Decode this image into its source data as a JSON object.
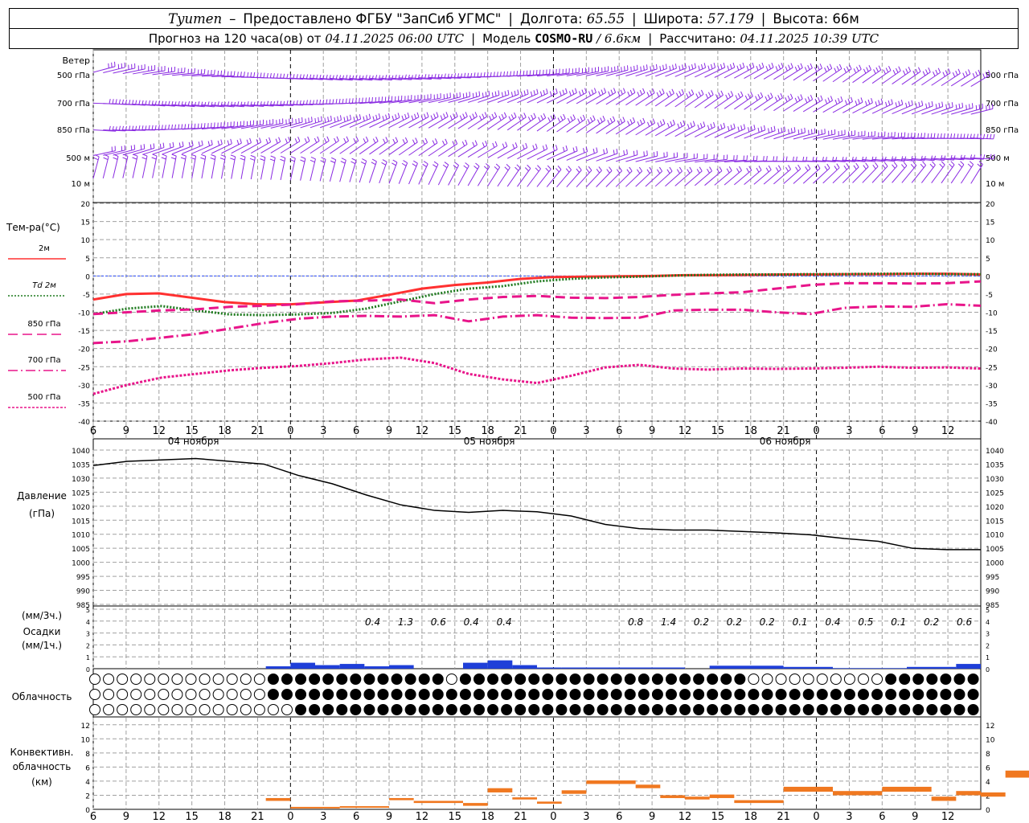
{
  "header": {
    "station": "Tyumen",
    "provider": "Предоставлено ФГБУ \"ЗапСиб УГМС\"",
    "lon_label": "Долгота:",
    "lon_value": "65.55",
    "lat_label": "Широта:",
    "lat_value": "57.179",
    "alt_label": "Высота:",
    "alt_value": "66м",
    "forecast_prefix": "Прогноз на 120 часа(ов) от",
    "forecast_time": "04.11.2025 06:00 UTC",
    "model_label": "Модель",
    "model_name": "COSMO-RU",
    "model_res": "/ 6.6км",
    "calc_label": "Рассчитано:",
    "calc_time": "04.11.2025 10:39 UTC"
  },
  "colors": {
    "wind": "#8a2be2",
    "t2m": "#ff3030",
    "td2m": "#1e7a1e",
    "t850": "#e8158a",
    "t700": "#e8158a",
    "t500": "#e8158a",
    "pressure": "#000000",
    "precip3h": "#1f3fd8",
    "precip1h": "#2bb52b",
    "conv": "#f07820",
    "grid": "#a0a0a0"
  },
  "chart_data": [
    {
      "type": "barbs",
      "title": "Ветер",
      "levels": [
        "500 гПа",
        "700 гПа",
        "850 гПа",
        "500 м",
        "10 м"
      ]
    },
    {
      "type": "line",
      "ylabel": "Тем-ра(°C)",
      "ylim": [
        -40,
        20
      ],
      "yticks": [
        -40,
        -35,
        -30,
        -25,
        -20,
        -15,
        -10,
        -5,
        0,
        5,
        10,
        15,
        20
      ],
      "x_hours": [
        6,
        9,
        12,
        15,
        18,
        21,
        0,
        3,
        6,
        9,
        12,
        15,
        18,
        21,
        0,
        3,
        6,
        9,
        12,
        15,
        18,
        21,
        0,
        3,
        6,
        9,
        12
      ],
      "day_labels": [
        "04 ноября",
        "05 ноября",
        "06 ноября"
      ],
      "series": [
        {
          "name": "2м",
          "style": "solid",
          "values": [
            -6.5,
            -5,
            -4.8,
            -6,
            -7.2,
            -7.8,
            -7.8,
            -7.3,
            -6.8,
            -5.2,
            -3.5,
            -2.5,
            -1.8,
            -0.8,
            -0.3,
            -0.2,
            -0.1,
            0,
            0.2,
            0.2,
            0.3,
            0.4,
            0.4,
            0.5,
            0.5,
            0.6,
            0.6,
            0.4
          ]
        },
        {
          "name": "Td 2м",
          "style": "dotted",
          "values": [
            -10.5,
            -9,
            -8.3,
            -9.5,
            -10.6,
            -10.8,
            -10.6,
            -10.2,
            -9,
            -7,
            -5,
            -3.5,
            -2.8,
            -1.5,
            -0.8,
            -0.4,
            -0.2,
            0.1,
            0.3,
            0.4,
            0.4,
            0.5,
            0.5,
            0.6,
            0.6,
            0.5,
            0.5
          ]
        },
        {
          "name": "850 гПа",
          "style": "dash",
          "values": [
            -10.5,
            -10,
            -9.5,
            -9.2,
            -8.5,
            -8.2,
            -7.8,
            -7,
            -6.8,
            -6.5,
            -7.5,
            -6.5,
            -5.8,
            -5.5,
            -6,
            -6.1,
            -5.8,
            -5.2,
            -4.8,
            -4.5,
            -3.5,
            -2.5,
            -2,
            -2,
            -2.1,
            -2,
            -1.5
          ]
        },
        {
          "name": "700 гПа",
          "style": "dashdot",
          "values": [
            -18.5,
            -18,
            -17,
            -16,
            -14.5,
            -13,
            -11.8,
            -11.2,
            -11,
            -11.2,
            -10.8,
            -12.5,
            -11.2,
            -10.8,
            -11.5,
            -11.6,
            -11.5,
            -9.5,
            -9.3,
            -9.3,
            -10,
            -10.5,
            -8.8,
            -8.4,
            -8.5,
            -7.8,
            -8.2
          ]
        },
        {
          "name": "500 гПа",
          "style": "dot",
          "values": [
            -32.5,
            -30,
            -28,
            -27,
            -26,
            -25.3,
            -24.8,
            -24,
            -23,
            -22.5,
            -24,
            -27,
            -28.5,
            -29.5,
            -27.5,
            -25.2,
            -24.5,
            -25.5,
            -25.8,
            -25.5,
            -25.6,
            -25.5,
            -25.3,
            -25,
            -25.3,
            -25.2,
            -25.5
          ]
        }
      ]
    },
    {
      "type": "line",
      "ylabel": "Давление",
      "unit": "(гПа)",
      "ylim": [
        985,
        1040
      ],
      "yticks": [
        985,
        990,
        995,
        1000,
        1005,
        1010,
        1015,
        1020,
        1025,
        1030,
        1035,
        1040
      ],
      "values": [
        1034.5,
        1036,
        1036.5,
        1037,
        1036,
        1035,
        1031,
        1028,
        1024,
        1020.5,
        1018.5,
        1017.8,
        1018.5,
        1018,
        1016.5,
        1013.5,
        1012,
        1011.5,
        1011.5,
        1011,
        1010.5,
        1009.8,
        1008.5,
        1007.5,
        1005,
        1004.5,
        1004.5
      ]
    },
    {
      "type": "bar",
      "ylabel_3h": "(мм/3ч.)",
      "title": "Осадки",
      "ylabel_1h": "(мм/1ч.)",
      "ylim": [
        0,
        5
      ],
      "totals": [
        {
          "hour_index": 8,
          "label": "0.4"
        },
        {
          "hour_index": 9,
          "label": "1.3"
        },
        {
          "hour_index": 10,
          "label": "0.6"
        },
        {
          "hour_index": 11,
          "label": "0.4"
        },
        {
          "hour_index": 12,
          "label": "0.4"
        },
        {
          "hour_index": 16,
          "label": "0.8"
        },
        {
          "hour_index": 17,
          "label": "1.4"
        },
        {
          "hour_index": 18,
          "label": "0.2"
        },
        {
          "hour_index": 19,
          "label": "0.2"
        },
        {
          "hour_index": 20,
          "label": "0.2"
        },
        {
          "hour_index": 21,
          "label": "0.1"
        },
        {
          "hour_index": 22,
          "label": "0.4"
        },
        {
          "hour_index": 23,
          "label": "0.5"
        },
        {
          "hour_index": 24,
          "label": "0.1"
        },
        {
          "hour_index": 25,
          "label": "0.2"
        },
        {
          "hour_index": 26,
          "label": "0.6"
        }
      ],
      "bars3h": [
        {
          "start_hour": 21,
          "end_hour": 24,
          "value": 0.2
        },
        {
          "start_hour": 24,
          "end_hour": 27,
          "value": 0.5
        },
        {
          "start_hour": 27,
          "end_hour": 30,
          "value": 0.3
        },
        {
          "start_hour": 30,
          "end_hour": 33,
          "value": 0.4
        },
        {
          "start_hour": 33,
          "end_hour": 36,
          "value": 0.2
        },
        {
          "start_hour": 36,
          "end_hour": 39,
          "value": 0.3
        },
        {
          "start_hour": 45,
          "end_hour": 48,
          "value": 0.5
        },
        {
          "start_hour": 48,
          "end_hour": 51,
          "value": 0.7
        },
        {
          "start_hour": 51,
          "end_hour": 54,
          "value": 0.3
        },
        {
          "start_hour": 54,
          "end_hour": 57,
          "value": 0.1
        },
        {
          "start_hour": 57,
          "end_hour": 63,
          "value": 0.1
        },
        {
          "start_hour": 63,
          "end_hour": 72,
          "value": 0.1
        },
        {
          "start_hour": 75,
          "end_hour": 84,
          "value": 0.25
        },
        {
          "start_hour": 84,
          "end_hour": 90,
          "value": 0.15
        },
        {
          "start_hour": 90,
          "end_hour": 99,
          "value": 0.05
        },
        {
          "start_hour": 99,
          "end_hour": 105,
          "value": 0.15
        },
        {
          "start_hour": 105,
          "end_hour": 108,
          "value": 0.4
        }
      ]
    },
    {
      "type": "table",
      "title": "Облачность",
      "rows": 3
    },
    {
      "type": "bar",
      "title": "Конвективн. облачность",
      "unit": "(км)",
      "ylim": [
        0,
        13
      ],
      "yticks": [
        0,
        2,
        4,
        6,
        8,
        10,
        12
      ],
      "layers": [
        {
          "start_hour": 21,
          "end_hour": 24,
          "base": 1.2,
          "top": 1.6
        },
        {
          "start_hour": 24,
          "end_hour": 30,
          "base": 0.2,
          "top": 0.35
        },
        {
          "start_hour": 30,
          "end_hour": 36,
          "base": 0.25,
          "top": 0.45
        },
        {
          "start_hour": 36,
          "end_hour": 39,
          "base": 1.3,
          "top": 1.6
        },
        {
          "start_hour": 39,
          "end_hour": 45,
          "base": 0.9,
          "top": 1.2
        },
        {
          "start_hour": 45,
          "end_hour": 48,
          "base": 0.5,
          "top": 0.9
        },
        {
          "start_hour": 48,
          "end_hour": 51,
          "base": 2.4,
          "top": 3.0
        },
        {
          "start_hour": 51,
          "end_hour": 54,
          "base": 1.4,
          "top": 1.7
        },
        {
          "start_hour": 54,
          "end_hour": 57,
          "base": 0.8,
          "top": 1.1
        },
        {
          "start_hour": 57,
          "end_hour": 60,
          "base": 2.2,
          "top": 2.7
        },
        {
          "start_hour": 60,
          "end_hour": 66,
          "base": 3.6,
          "top": 4.1
        },
        {
          "start_hour": 66,
          "end_hour": 69,
          "base": 3.0,
          "top": 3.5
        },
        {
          "start_hour": 69,
          "end_hour": 72,
          "base": 1.6,
          "top": 2.0
        },
        {
          "start_hour": 72,
          "end_hour": 75,
          "base": 1.4,
          "top": 1.8
        },
        {
          "start_hour": 75,
          "end_hour": 78,
          "base": 1.6,
          "top": 2.1
        },
        {
          "start_hour": 78,
          "end_hour": 84,
          "base": 0.9,
          "top": 1.3
        },
        {
          "start_hour": 84,
          "end_hour": 90,
          "base": 2.5,
          "top": 3.2
        },
        {
          "start_hour": 90,
          "end_hour": 96,
          "base": 2.0,
          "top": 2.6
        },
        {
          "start_hour": 96,
          "end_hour": 102,
          "base": 2.5,
          "top": 3.2
        },
        {
          "start_hour": 102,
          "end_hour": 105,
          "base": 1.2,
          "top": 1.8
        },
        {
          "start_hour": 105,
          "end_hour": 108,
          "base": 2.0,
          "top": 2.6
        },
        {
          "start_hour": 108,
          "end_hour": 111,
          "base": 1.8,
          "top": 2.4
        },
        {
          "start_hour": 111,
          "end_hour": 114,
          "base": 4.5,
          "top": 5.5
        },
        {
          "start_hour": 114,
          "end_hour": 117,
          "base": 2.2,
          "top": 2.7
        },
        {
          "start_hour": 117,
          "end_hour": 120,
          "base": 2.3,
          "top": 2.8
        }
      ]
    }
  ]
}
